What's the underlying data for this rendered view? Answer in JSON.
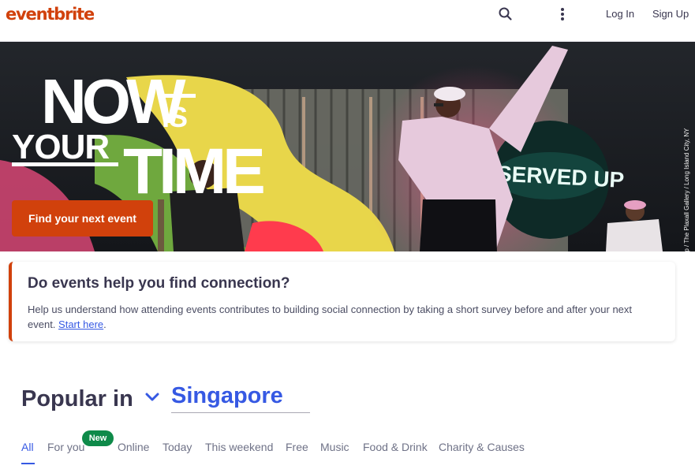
{
  "brand": {
    "name": "eventbrite",
    "color": "#d1410c"
  },
  "header": {
    "search_icon": "search-icon",
    "more_icon": "more-vertical-icon",
    "login": "Log In",
    "signup": "Sign Up"
  },
  "hero": {
    "headline": {
      "line1": "NOW",
      "line1b": "IS",
      "line2a": "YOUR",
      "line2b": "TIME"
    },
    "stage_sign": "SERVED UP",
    "photo_credit": "Served Up / The Plaxall Gallery / Long Island City, NY",
    "cta": "Find your next event"
  },
  "survey": {
    "title": "Do events help you find connection?",
    "text": "Help us understand how attending events contributes to building social connection by taking a short survey before and after your next event.",
    "link": "Start here",
    "trailing": ".",
    "accent": "#d1410c"
  },
  "popular": {
    "label": "Popular in",
    "location": "Singapore",
    "chevron_icon": "chevron-down-icon",
    "accent": "#3659e3"
  },
  "tabs": [
    {
      "label": "All",
      "active": true
    },
    {
      "label": "For you",
      "badge": "New"
    },
    {
      "label": "Online"
    },
    {
      "label": "Today"
    },
    {
      "label": "This weekend"
    },
    {
      "label": "Free"
    },
    {
      "label": "Music"
    },
    {
      "label": "Food & Drink"
    },
    {
      "label": "Charity & Causes"
    }
  ]
}
